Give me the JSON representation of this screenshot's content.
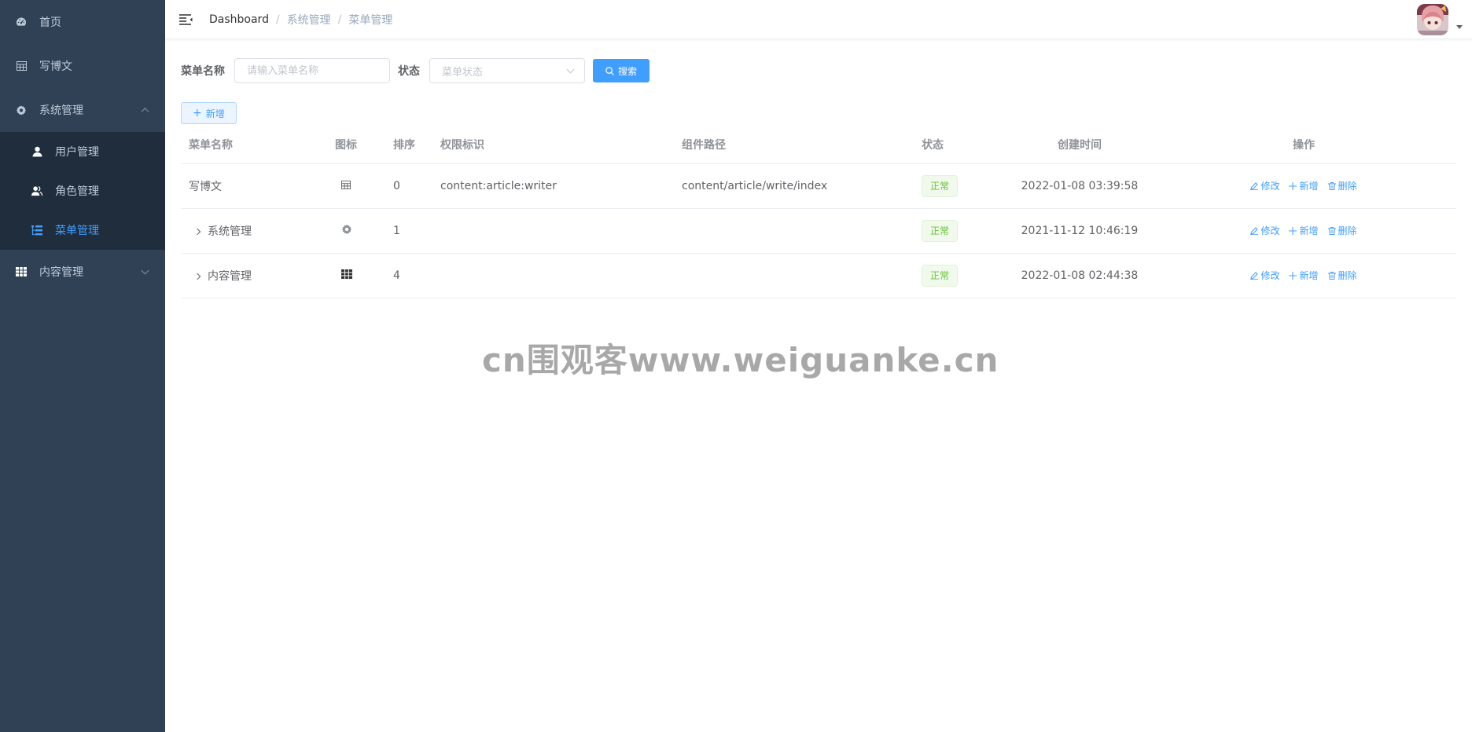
{
  "sidebar": {
    "items": [
      {
        "label": "首页",
        "icon": "dashboard-icon"
      },
      {
        "label": "写博文",
        "icon": "table-icon"
      },
      {
        "label": "系统管理",
        "icon": "gear-icon",
        "expanded": true,
        "children": [
          {
            "label": "用户管理",
            "icon": "user-icon"
          },
          {
            "label": "角色管理",
            "icon": "peoples-icon"
          },
          {
            "label": "菜单管理",
            "icon": "tree-table-icon",
            "active": true
          }
        ]
      },
      {
        "label": "内容管理",
        "icon": "grid-icon",
        "expanded": false
      }
    ],
    "colors": {
      "bg": "#304156",
      "sub_bg": "#1f2d3d",
      "active": "#409eff"
    }
  },
  "navbar": {
    "breadcrumb": [
      "Dashboard",
      "系统管理",
      "菜单管理"
    ],
    "separator": "/"
  },
  "search": {
    "name_label": "菜单名称",
    "name_placeholder": "请输入菜单名称",
    "status_label": "状态",
    "status_placeholder": "菜单状态",
    "search_button": "搜索"
  },
  "toolbar": {
    "add_button": "新增"
  },
  "table": {
    "headers": [
      "菜单名称",
      "图标",
      "排序",
      "权限标识",
      "组件路径",
      "状态",
      "创建时间",
      "操作"
    ],
    "rows": [
      {
        "name": "写博文",
        "icon": "table-icon",
        "order": "0",
        "perms": "content:article:writer",
        "component": "content/article/write/index",
        "status": "正常",
        "created": "2022-01-08 03:39:58",
        "expandable": false
      },
      {
        "name": "系统管理",
        "icon": "gear-icon",
        "order": "1",
        "perms": "",
        "component": "",
        "status": "正常",
        "created": "2021-11-12 10:46:19",
        "expandable": true
      },
      {
        "name": "内容管理",
        "icon": "grid-icon",
        "order": "4",
        "perms": "",
        "component": "",
        "status": "正常",
        "created": "2022-01-08 02:44:38",
        "expandable": true
      }
    ],
    "actions": {
      "edit": "修改",
      "add": "新增",
      "delete": "删除"
    }
  },
  "watermark": "cn围观客www.weiguanke.cn",
  "theme": {
    "primary": "#409eff",
    "success": "#67c23a"
  }
}
